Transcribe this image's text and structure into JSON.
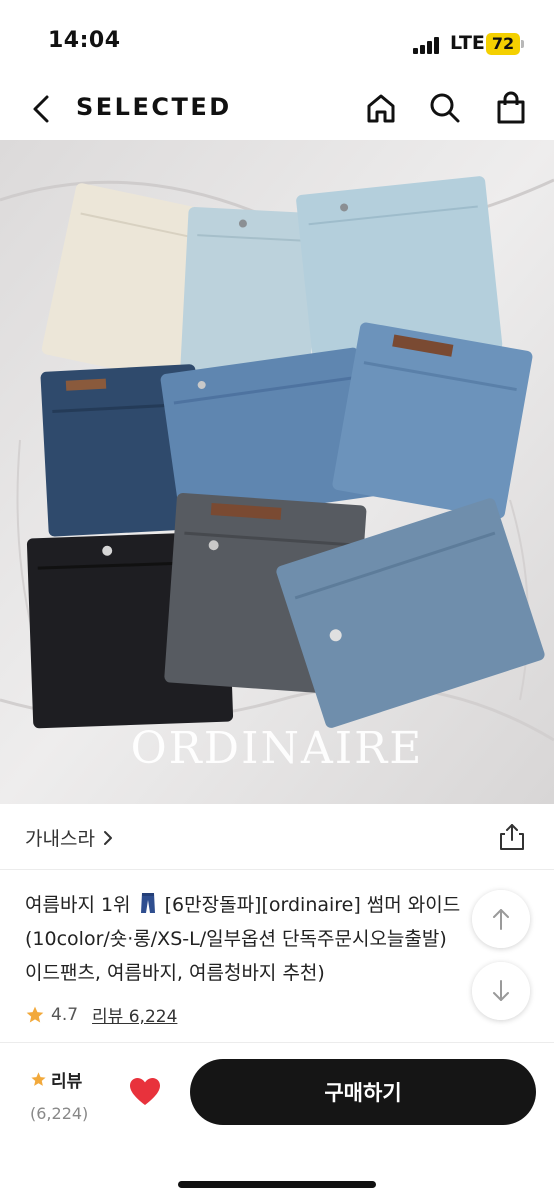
{
  "status_bar": {
    "time": "14:04",
    "network": "LTE",
    "battery": "72",
    "battery_color": "#f4d000"
  },
  "nav": {
    "title": "SELECTED",
    "icons": [
      "back-arrow-icon",
      "home-icon",
      "search-icon",
      "shopping-bag-icon"
    ]
  },
  "product_image": {
    "brand_text": "ORDINAIRE"
  },
  "store": {
    "name": "가내스라",
    "chevron": "›"
  },
  "product": {
    "title_part1": "여름바지 1위",
    "title_part2": "[6만장돌파][ordinaire] 썸머 와이드",
    "title_line2": "(10color/숏·롱/XS-L/일부옵션 단독주문시오늘출발)",
    "title_line3": "이드팬츠, 여름바지, 여름청바지 추천)",
    "rating": "4.7",
    "review_link": "리뷰 6,224",
    "star_color": "#f2a93b"
  },
  "bottom_bar": {
    "review_label": "리뷰",
    "review_count": "(6,224)",
    "buy_label": "구매하기",
    "heart_color": "#e8323c",
    "button_color": "#151515"
  }
}
